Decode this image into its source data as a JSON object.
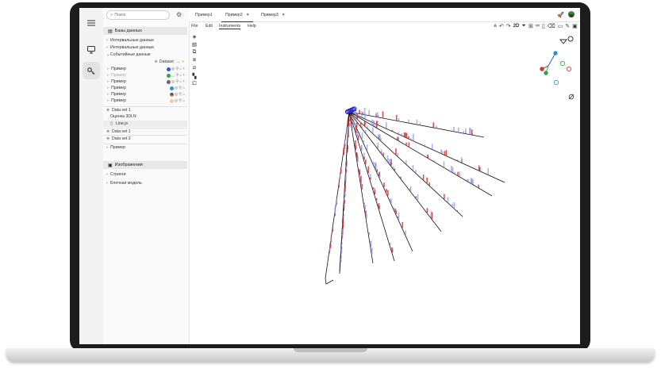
{
  "search": {
    "placeholder": "Поиск"
  },
  "tabs": [
    {
      "label": "Пример1",
      "close": ""
    },
    {
      "label": "Пример2",
      "close": "×"
    },
    {
      "label": "Пример3",
      "close": "×"
    }
  ],
  "menu": [
    "File",
    "Edit",
    "Instruments",
    "Help"
  ],
  "toolbar": {
    "mode": "2D"
  },
  "sidebar": {
    "databases": "Базы данных",
    "interval1": "Интервальные данные",
    "interval2": "Интервальные данные",
    "events": "Событийные данные",
    "dataset": "Dataset",
    "examples": [
      "Пример",
      "Пример",
      "Пример",
      "Пример",
      "Пример",
      "Пример"
    ],
    "dataset1": "Data set 1",
    "estimate": "Оценка 3DLN",
    "linejs": "Line.js",
    "dataset1b": "Data set 1",
    "dataset2": "Data set 2",
    "example_leaf": "Пример",
    "images": "Изображения",
    "strings": "Стринги",
    "block": "Блочная модель"
  },
  "colors": {
    "accent": "#2323c8",
    "red": "#d43434",
    "blue": "#8a93e8",
    "green": "#2ea24a"
  }
}
